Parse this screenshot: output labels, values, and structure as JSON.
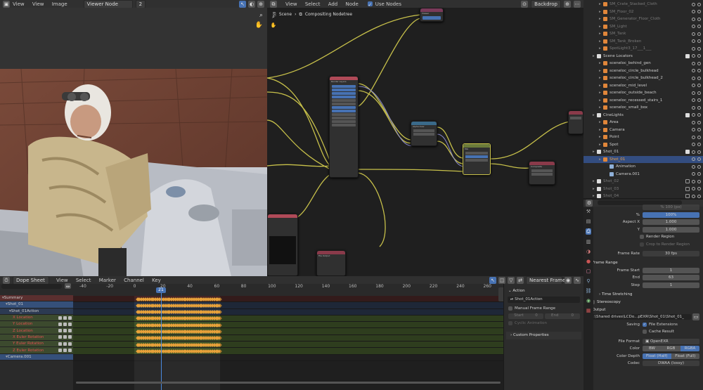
{
  "viewer_header": {
    "menus": [
      "View",
      "View",
      "Image"
    ],
    "slot": "Viewer Node",
    "slot_count": "2"
  },
  "node_header": {
    "menus": [
      "View",
      "Select",
      "Add",
      "Node"
    ],
    "use_nodes_label": "Use Nodes",
    "backdrop_label": "Backdrop"
  },
  "breadcrumb": {
    "scene": "Scene",
    "tree": "Compositing Nodetree"
  },
  "outliner": {
    "rows": [
      {
        "name": "SM_Crate_Stacked_Cloth",
        "indent": 2,
        "color": "#e0863a",
        "dim": true
      },
      {
        "name": "SM_Floor_02",
        "indent": 2,
        "color": "#e0863a",
        "dim": true
      },
      {
        "name": "SM_Generator_Floor_Cloth",
        "indent": 2,
        "color": "#e0863a",
        "dim": true
      },
      {
        "name": "SM_Light",
        "indent": 2,
        "color": "#e0863a",
        "dim": true
      },
      {
        "name": "SM_Tank",
        "indent": 2,
        "color": "#e0863a",
        "dim": true
      },
      {
        "name": "SM_Tank_Broken",
        "indent": 2,
        "color": "#e0863a",
        "dim": true
      },
      {
        "name": "SpotLight3_17___1___",
        "indent": 2,
        "color": "#e0863a",
        "dim": true
      },
      {
        "name": "Scene Locators",
        "indent": 1,
        "color": "#dddddd",
        "dim": false
      },
      {
        "name": "sceneloc_behind_gen",
        "indent": 2,
        "color": "#e0863a",
        "dim": false
      },
      {
        "name": "sceneloc_circle_bulkhead",
        "indent": 2,
        "color": "#e0863a",
        "dim": false
      },
      {
        "name": "sceneloc_circle_bulkhead_2",
        "indent": 2,
        "color": "#e0863a",
        "dim": false
      },
      {
        "name": "sceneloc_mid_level",
        "indent": 2,
        "color": "#e0863a",
        "dim": false
      },
      {
        "name": "sceneloc_outside_beach",
        "indent": 2,
        "color": "#e0863a",
        "dim": false
      },
      {
        "name": "sceneloc_recessed_stairs_1",
        "indent": 2,
        "color": "#e0863a",
        "dim": false
      },
      {
        "name": "sceneloc_small_box",
        "indent": 2,
        "color": "#e0863a",
        "dim": false
      },
      {
        "name": "CineLights",
        "indent": 1,
        "color": "#dddddd",
        "dim": false
      },
      {
        "name": "Area",
        "indent": 2,
        "color": "#e0863a",
        "dim": false
      },
      {
        "name": "Camera",
        "indent": 2,
        "color": "#e0863a",
        "dim": false
      },
      {
        "name": "Point",
        "indent": 2,
        "color": "#e0863a",
        "dim": false
      },
      {
        "name": "Spot",
        "indent": 2,
        "color": "#e0863a",
        "dim": false
      },
      {
        "name": "Shot_01",
        "indent": 1,
        "color": "#dddddd",
        "dim": false
      },
      {
        "name": "Shot_01",
        "indent": 2,
        "color": "#e0863a",
        "dim": false,
        "active": true
      },
      {
        "name": "Animation",
        "indent": 3,
        "color": "#8fb0d8",
        "dim": false
      },
      {
        "name": "Camera.001",
        "indent": 3,
        "color": "#8fb0d8",
        "dim": false
      },
      {
        "name": "Shot_02",
        "indent": 1,
        "color": "#dddddd",
        "dim": true
      },
      {
        "name": "Shot_03",
        "indent": 1,
        "color": "#dddddd",
        "dim": true
      },
      {
        "name": "Shot_04",
        "indent": 1,
        "color": "#dddddd",
        "dim": true
      }
    ]
  },
  "properties": {
    "top_value": "% 100 (px)",
    "percent_label": "%",
    "percent_value": "100%",
    "aspect_x_label": "Aspect X",
    "aspect_x": "1.000",
    "aspect_y_label": "Y",
    "aspect_y": "1.000",
    "render_region": "Render Region",
    "crop_region": "Crop to Render Region",
    "frame_rate_label": "Frame Rate",
    "frame_rate": "30 fps",
    "frame_range_title": "Frame Range",
    "frame_start_label": "Frame Start",
    "frame_start": "1",
    "end_label": "End",
    "end": "63",
    "step_label": "Step",
    "step": "1",
    "time_stretching": "Time Stretching",
    "stereoscopy": "Stereoscopy",
    "output_title": "Output",
    "output_path": "G:\\Shared drives\\LCDo...pEXR\\Shot_01\\Shot_01_",
    "saving_label": "Saving",
    "file_extensions": "File Extensions",
    "cache_result": "Cache Result",
    "file_format_label": "File Format",
    "file_format": "OpenEXR",
    "color_label": "Color",
    "color_options": [
      "BW",
      "RGB",
      "RGBA"
    ],
    "color_depth_label": "Color Depth",
    "depth_options": [
      "Float (Half)",
      "Float (Full)"
    ],
    "codec_label": "Codec",
    "codec": "DWAA (lossy)"
  },
  "dope": {
    "editor": "Dope Sheet",
    "menus": [
      "View",
      "Select",
      "Marker",
      "Channel",
      "Key"
    ],
    "snap": "Nearest Frame",
    "ruler": [
      "-40",
      "-20",
      "0",
      "20",
      "40",
      "60",
      "80",
      "100",
      "120",
      "140",
      "160",
      "180",
      "200",
      "220",
      "240",
      "260"
    ],
    "current_frame": "21",
    "channels": [
      {
        "name": "Summary",
        "bg": "#5a2f2f",
        "indent": 0
      },
      {
        "name": "Shot_01",
        "bg": "#35507a",
        "indent": 1
      },
      {
        "name": "Shot_01Action",
        "bg": "#2c3a52",
        "indent": 2
      },
      {
        "name": "X Location",
        "bg": "#3c4a2e",
        "indent": 3,
        "red": true
      },
      {
        "name": "Y Location",
        "bg": "#3c4a2e",
        "indent": 3,
        "red": true
      },
      {
        "name": "Z Location",
        "bg": "#3c4a2e",
        "indent": 3,
        "red": true
      },
      {
        "name": "X Euler Rotation",
        "bg": "#3c4a2e",
        "indent": 3,
        "red": true
      },
      {
        "name": "Y Euler Rotation",
        "bg": "#3c4a2e",
        "indent": 3,
        "red": true
      },
      {
        "name": "Z Euler Rotation",
        "bg": "#3c4a2e",
        "indent": 3,
        "red": true
      },
      {
        "name": "Camera.001",
        "bg": "#35507a",
        "indent": 1
      }
    ],
    "sidebar": {
      "action_title": "Action",
      "action_name": "Shot_01Action",
      "manual_range": "Manual Frame Range",
      "start_label": "Start",
      "start_value": "0",
      "end_label": "End",
      "end_value": "0",
      "cyclic": "Cyclic Animation",
      "custom_props": "Custom Properties"
    }
  },
  "nodes": {
    "n_rlayers": {
      "title": "Render Layers"
    },
    "n_viewer": {
      "title": "Viewer"
    },
    "n_alpha": {
      "title": "Alpha Over"
    },
    "n_mix": {
      "title": "Mix"
    },
    "n_comp": {
      "title": "Composite"
    },
    "n_file": {
      "title": "File Output"
    }
  }
}
